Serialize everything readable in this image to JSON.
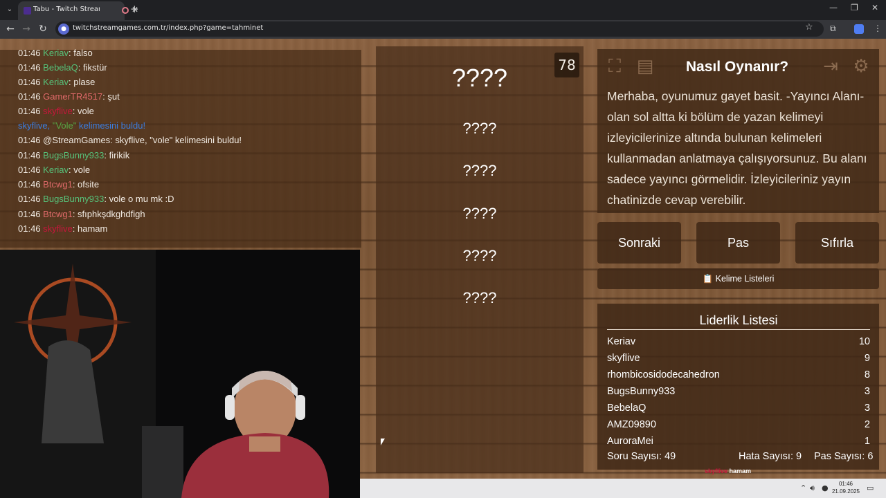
{
  "browser": {
    "tab_title": "Tabu - Twitch Stream Games",
    "tab_close": "✕",
    "new_tab": "+",
    "url": "twitchstreamgames.com.tr/index.php?game=tahminet",
    "icons": [
      "tab-list-icon",
      "back-arrow-icon",
      "forward-arrow-icon",
      "reload-icon",
      "site-info-icon",
      "bookmark-star-icon",
      "extensions-icon",
      "profile-icon",
      "menu-dots-icon"
    ]
  },
  "chat": {
    "messages": [
      {
        "time": "01:46",
        "user": "Keriav",
        "color": "#57c27a",
        "text": ": falso"
      },
      {
        "time": "01:46",
        "user": "BebelaQ",
        "color": "#57c27a",
        "text": ": fikstür"
      },
      {
        "time": "01:46",
        "user": "Keriav",
        "color": "#57c27a",
        "text": ": plase"
      },
      {
        "time": "01:46",
        "user": "GamerTR4517",
        "color": "#e06a6a",
        "text": ": şut"
      },
      {
        "time": "01:46",
        "user": "skyflive",
        "color": "#c8163c",
        "text": ": vole"
      },
      {
        "time": "01:46",
        "user": "@StreamGames",
        "color": "#f2ece4",
        "text": ": skyflive, \"vole\" kelimesini buldu!"
      },
      {
        "time": "01:46",
        "user": "BugsBunny933",
        "color": "#57c27a",
        "text": ": firikik"
      },
      {
        "time": "01:46",
        "user": "Keriav",
        "color": "#57c27a",
        "text": ": vole"
      },
      {
        "time": "01:46",
        "user": "Btcwg1",
        "color": "#e06a6a",
        "text": ": ofsite"
      },
      {
        "time": "01:46",
        "user": "BugsBunny933",
        "color": "#57c27a",
        "text": ": vole o mu mk :D"
      },
      {
        "time": "01:46",
        "user": "Btcwg1",
        "color": "#e06a6a",
        "text": ": sfıphkşdkghdfigh"
      },
      {
        "time": "01:46",
        "user": "skyflive",
        "color": "#c8163c",
        "text": ": hamam"
      }
    ],
    "system_notice": {
      "user": "skyflive",
      "sep": ", ",
      "word": "\"Vole\"",
      "text": " kelimesini buldu!"
    }
  },
  "game": {
    "timer": "78",
    "main_word": "????",
    "forbidden_words": [
      "????",
      "????",
      "????",
      "????",
      "????"
    ]
  },
  "help": {
    "title": "Nasıl Oynanır?",
    "text": "Merhaba, oyunumuz gayet basit. -Yayıncı Alanı- olan sol altta ki bölüm de yazan kelimeyi izleyicilerinize altında bulunan kelimeleri kullanmadan anlatmaya çalışıyorsunuz. Bu alanı sadece yayıncı görmelidir. İzleyicileriniz yayın chatinizde cevap verebilir.",
    "icons": [
      "fullscreen-icon",
      "notes-icon",
      "logout-icon",
      "settings-gear-icon"
    ]
  },
  "controls": {
    "next": "Sonraki",
    "pass": "Pas",
    "reset": "Sıfırla",
    "word_lists": "Kelime Listeleri",
    "word_lists_icon": "📋"
  },
  "leaderboard": {
    "title": "Liderlik Listesi",
    "rows": [
      {
        "name": "Keriav",
        "score": "10"
      },
      {
        "name": "skyflive",
        "score": "9"
      },
      {
        "name": "rhombicosidodecahedron",
        "score": "8"
      },
      {
        "name": "BugsBunny933",
        "score": "3"
      },
      {
        "name": "BebelaQ",
        "score": "3"
      },
      {
        "name": "AMZ09890",
        "score": "2"
      },
      {
        "name": "AuroraMei",
        "score": "1"
      }
    ],
    "stats": {
      "questions_label": "Soru Sayısı:",
      "questions": "49",
      "errors_label": "Hata Sayısı:",
      "errors": "9",
      "passes_label": "Pas Sayısı:",
      "passes": "6"
    }
  },
  "overlay": {
    "user": "skyflive",
    "text": "hamam"
  },
  "taskbar": {
    "time": "01:46",
    "date": "21.09.2025"
  }
}
